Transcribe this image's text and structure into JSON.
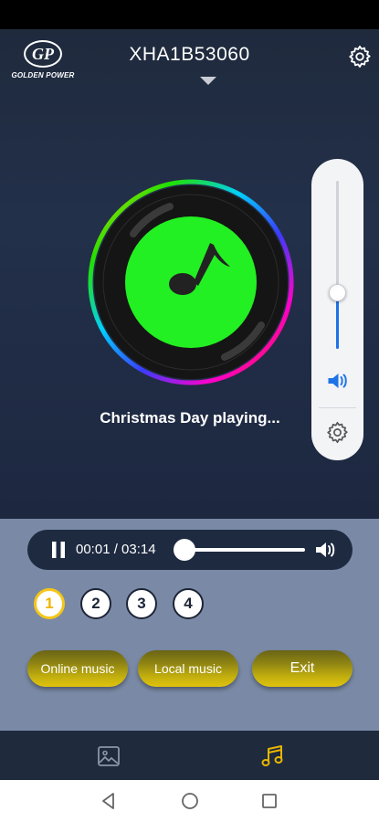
{
  "logo": {
    "mark": "GP",
    "name": "GOLDEN POWER"
  },
  "header": {
    "device_id": "XHA1B53060"
  },
  "player": {
    "now_playing": "Christmas Day playing...",
    "time": "00:01 / 03:14",
    "progress_fraction": 0.01,
    "volume_fraction": 0.34
  },
  "playlists": [
    {
      "label": "1",
      "active": true
    },
    {
      "label": "2",
      "active": false
    },
    {
      "label": "3",
      "active": false
    },
    {
      "label": "4",
      "active": false
    }
  ],
  "buttons": {
    "online_music": "Online music",
    "local_music": "Local music",
    "exit": "Exit"
  },
  "icons": {
    "settings": "gear-icon",
    "volume": "speaker-icon",
    "pause": "pause-icon",
    "gallery": "image-icon",
    "music": "music-note-icon",
    "back": "back-triangle-icon",
    "home": "home-circle-icon",
    "recent": "recent-square-icon"
  },
  "colors": {
    "accent_gold": "#f5c617",
    "volume_blue": "#1e73e8",
    "disc_green": "#22f022"
  }
}
